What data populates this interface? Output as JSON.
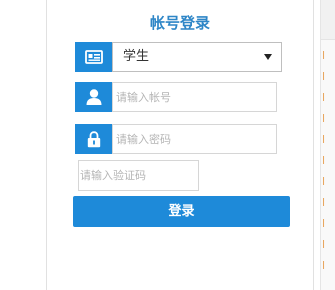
{
  "login": {
    "title": "帐号登录",
    "role_select": {
      "selected": "学生",
      "icon": "id-card-icon"
    },
    "account_field": {
      "placeholder": "请输入帐号",
      "icon": "user-icon"
    },
    "password_field": {
      "placeholder": "请输入密码",
      "icon": "lock-icon"
    },
    "captcha_field": {
      "placeholder": "请输入验证码"
    },
    "login_button": "登录"
  },
  "side_list": {
    "marks": [
      "l",
      "l",
      "l",
      "l",
      "l",
      "l",
      "l",
      "l",
      "l",
      "l",
      "l"
    ]
  },
  "colors": {
    "accent": "#1e8ad9",
    "title": "#2e86c7",
    "marker": "#e8a45a"
  }
}
